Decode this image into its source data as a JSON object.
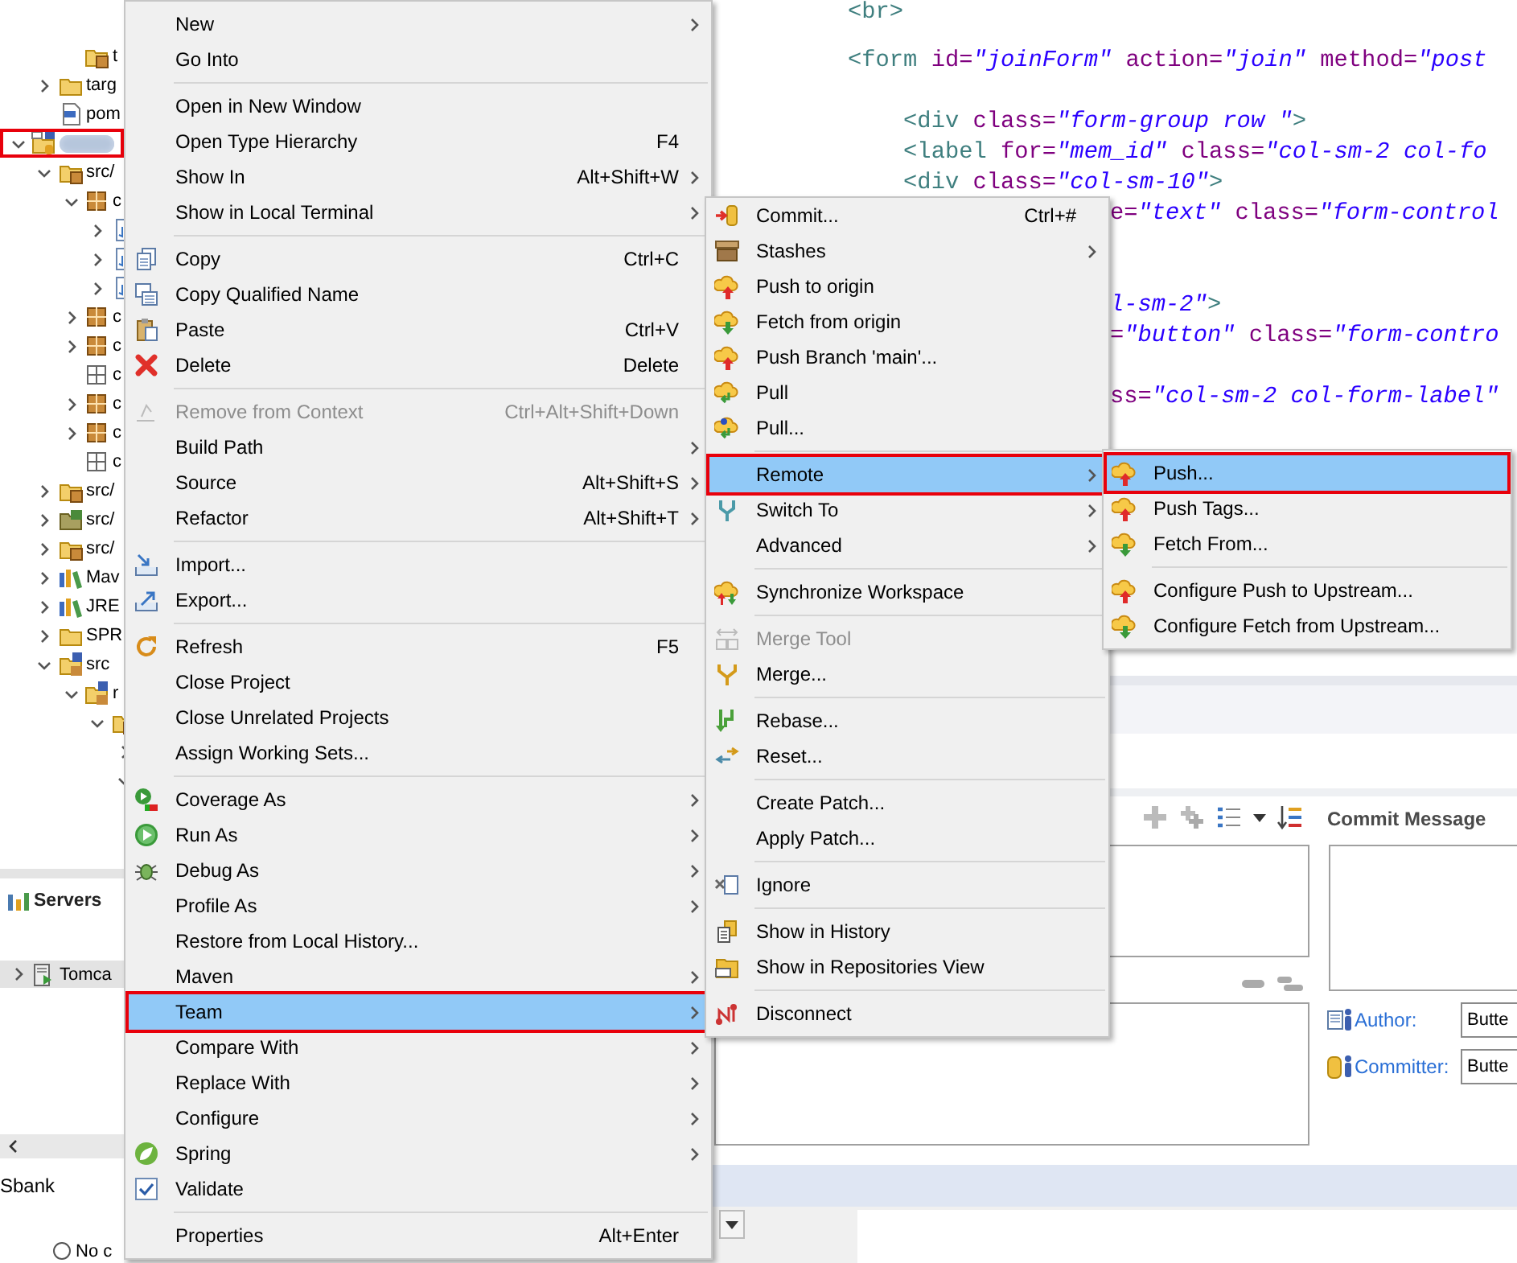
{
  "project_explorer": {
    "tree": [
      {
        "kind": "offscreen",
        "children": [
          {
            "kind": "offscreen",
            "children": [
              {
                "label": "t",
                "kind": "source-folder"
              }
            ]
          },
          {
            "label": "targ",
            "kind": "folder",
            "expanded": false
          },
          {
            "label": "pom",
            "kind": "pom"
          }
        ]
      },
      {
        "kind": "project",
        "redacted": true,
        "callout": true,
        "expanded": true,
        "children": [
          {
            "label": "src/",
            "kind": "source-folder",
            "expanded": true,
            "children": [
              {
                "label": "c",
                "kind": "package",
                "expanded": true,
                "children": [
                  {
                    "kind": "file",
                    "expanded": false
                  },
                  {
                    "kind": "file",
                    "expanded": false
                  },
                  {
                    "kind": "file",
                    "expanded": false
                  }
                ]
              },
              {
                "label": "c",
                "kind": "package",
                "expanded": false
              },
              {
                "label": "c",
                "kind": "package",
                "expanded": false
              },
              {
                "label": "c",
                "kind": "empty-package"
              },
              {
                "label": "c",
                "kind": "package",
                "expanded": false
              },
              {
                "label": "c",
                "kind": "package",
                "expanded": false
              },
              {
                "label": "c",
                "kind": "empty-package"
              }
            ]
          },
          {
            "label": "src/",
            "kind": "source-folder",
            "expanded": false
          },
          {
            "label": "src/",
            "kind": "resource-folder",
            "expanded": false
          },
          {
            "label": "src/",
            "kind": "source-folder",
            "expanded": false
          },
          {
            "label": "Mav",
            "kind": "library",
            "expanded": false
          },
          {
            "label": "JRE",
            "kind": "library",
            "expanded": false
          },
          {
            "label": "SPR",
            "kind": "folder",
            "expanded": false
          },
          {
            "label": "src",
            "kind": "spring-folder",
            "expanded": true,
            "children": [
              {
                "label": "r",
                "kind": "spring-folder",
                "expanded": true,
                "children": [
                  {
                    "kind": "source-folder",
                    "expanded": true,
                    "children": [
                      {
                        "expanded": false
                      },
                      {
                        "expanded": true
                      }
                    ]
                  }
                ]
              }
            ]
          }
        ]
      }
    ]
  },
  "servers_view": {
    "title": "Servers",
    "items": [
      {
        "label": "Tomca",
        "selected": true,
        "expanded": false
      }
    ]
  },
  "editor": {
    "lines": [
      {
        "kind": "full",
        "tokens": [
          {
            "kind": "tag",
            "t": "<br>"
          }
        ]
      },
      {
        "kind": "blank"
      },
      {
        "kind": "full",
        "tokens": [
          {
            "kind": "tag",
            "t": "<form"
          },
          {
            "kind": "attr",
            "t": " id="
          },
          {
            "kind": "val",
            "t": "\"joinForm\""
          },
          {
            "kind": "attr",
            "t": " action="
          },
          {
            "kind": "val",
            "t": "\"join\""
          },
          {
            "kind": "attr",
            "t": " method="
          },
          {
            "kind": "val",
            "t": "\"post"
          }
        ]
      },
      {
        "kind": "blank"
      },
      {
        "kind": "full",
        "tokens": [
          {
            "kind": "tag",
            "t": "    <div"
          },
          {
            "kind": "attr",
            "t": " class="
          },
          {
            "kind": "val",
            "t": "\"form-group row \""
          },
          {
            "kind": "tag",
            "t": ">"
          }
        ]
      },
      {
        "kind": "full",
        "tokens": [
          {
            "kind": "tag",
            "t": "    <label"
          },
          {
            "kind": "attr",
            "t": " for="
          },
          {
            "kind": "val",
            "t": "\"mem_id\""
          },
          {
            "kind": "attr",
            "t": " class="
          },
          {
            "kind": "val",
            "t": "\"col-sm-2 col-fo"
          }
        ]
      },
      {
        "kind": "full",
        "tokens": [
          {
            "kind": "tag",
            "t": "    <div"
          },
          {
            "kind": "attr",
            "t": " class="
          },
          {
            "kind": "val",
            "t": "\"col-sm-10\""
          },
          {
            "kind": "tag",
            "t": ">"
          }
        ]
      },
      {
        "kind": "tail",
        "tokens": [
          {
            "kind": "attr",
            "t": "e="
          },
          {
            "kind": "val",
            "t": "\"text\""
          },
          {
            "kind": "attr",
            "t": " class="
          },
          {
            "kind": "val",
            "t": "\"form-control"
          }
        ]
      },
      {
        "kind": "blank"
      },
      {
        "kind": "blank"
      },
      {
        "kind": "tail",
        "tokens": [
          {
            "kind": "val",
            "t": "l-sm-2\""
          },
          {
            "kind": "tag",
            "t": ">"
          }
        ]
      },
      {
        "kind": "tail",
        "tokens": [
          {
            "kind": "attr",
            "t": "="
          },
          {
            "kind": "val",
            "t": "\"button\""
          },
          {
            "kind": "attr",
            "t": " class="
          },
          {
            "kind": "val",
            "t": "\"form-contro"
          }
        ]
      },
      {
        "kind": "blank"
      },
      {
        "kind": "tail",
        "tokens": [
          {
            "kind": "attr",
            "t": "ss="
          },
          {
            "kind": "val",
            "t": "\"col-sm-2 col-form-label\""
          }
        ]
      }
    ]
  },
  "staging": {
    "commit_message": {
      "label": "Commit Message"
    },
    "author": {
      "label": "Author:",
      "value": "Butte"
    },
    "committer": {
      "label": "Committer:",
      "value": "Butte"
    }
  },
  "status_bar": {
    "project": "Sbank"
  },
  "bottom_panel": {
    "radio": {
      "label": "No c",
      "selected": false
    }
  },
  "menus": [
    {
      "sections": [
        {
          "items": [
            {
              "label": "New",
              "submenu": true,
              "selected": false,
              "disabled": false
            },
            {
              "label": "Go Into",
              "selected": false,
              "disabled": false
            }
          ]
        },
        {
          "items": [
            {
              "label": "Open in New Window",
              "selected": false,
              "disabled": false
            },
            {
              "label": "Open Type Hierarchy",
              "shortcut": "F4",
              "selected": false,
              "disabled": false
            },
            {
              "label": "Show In",
              "shortcut": "Alt+Shift+W",
              "submenu": true,
              "selected": false,
              "disabled": false
            },
            {
              "label": "Show in Local Terminal",
              "submenu": true,
              "selected": false,
              "disabled": false
            }
          ]
        },
        {
          "items": [
            {
              "label": "Copy",
              "shortcut": "Ctrl+C",
              "selected": false,
              "disabled": false
            },
            {
              "label": "Copy Qualified Name",
              "selected": false,
              "disabled": false
            },
            {
              "label": "Paste",
              "shortcut": "Ctrl+V",
              "selected": false,
              "disabled": false
            },
            {
              "label": "Delete",
              "shortcut": "Delete",
              "selected": false,
              "disabled": false
            }
          ]
        },
        {
          "items": [
            {
              "label": "Remove from Context",
              "shortcut": "Ctrl+Alt+Shift+Down",
              "selected": false,
              "disabled": true
            },
            {
              "label": "Build Path",
              "submenu": true,
              "selected": false,
              "disabled": false
            },
            {
              "label": "Source",
              "shortcut": "Alt+Shift+S",
              "submenu": true,
              "selected": false,
              "disabled": false
            },
            {
              "label": "Refactor",
              "shortcut": "Alt+Shift+T",
              "submenu": true,
              "selected": false,
              "disabled": false
            }
          ]
        },
        {
          "items": [
            {
              "label": "Import...",
              "selected": false,
              "disabled": false
            },
            {
              "label": "Export...",
              "selected": false,
              "disabled": false
            }
          ]
        },
        {
          "items": [
            {
              "label": "Refresh",
              "shortcut": "F5",
              "selected": false,
              "disabled": false
            },
            {
              "label": "Close Project",
              "selected": false,
              "disabled": false
            },
            {
              "label": "Close Unrelated Projects",
              "selected": false,
              "disabled": false
            },
            {
              "label": "Assign Working Sets...",
              "selected": false,
              "disabled": false
            }
          ]
        },
        {
          "items": [
            {
              "label": "Coverage As",
              "submenu": true,
              "selected": false,
              "disabled": false
            },
            {
              "label": "Run As",
              "submenu": true,
              "selected": false,
              "disabled": false
            },
            {
              "label": "Debug As",
              "submenu": true,
              "selected": false,
              "disabled": false
            },
            {
              "label": "Profile As",
              "submenu": true,
              "selected": false,
              "disabled": false
            },
            {
              "label": "Restore from Local History...",
              "selected": false,
              "disabled": false
            },
            {
              "label": "Maven",
              "submenu": true,
              "selected": false,
              "disabled": false
            },
            {
              "label": "Team",
              "submenu": true,
              "selected": true,
              "disabled": false,
              "callout": true
            },
            {
              "label": "Compare With",
              "submenu": true,
              "selected": false,
              "disabled": false
            },
            {
              "label": "Replace With",
              "submenu": true,
              "selected": false,
              "disabled": false
            },
            {
              "label": "Configure",
              "submenu": true,
              "selected": false,
              "disabled": false
            },
            {
              "label": "Spring",
              "submenu": true,
              "selected": false,
              "disabled": false
            },
            {
              "label": "Validate",
              "selected": false,
              "disabled": false
            }
          ]
        },
        {
          "items": [
            {
              "label": "Properties",
              "shortcut": "Alt+Enter",
              "selected": false,
              "disabled": false
            }
          ]
        }
      ]
    },
    {
      "sections": [
        {
          "items": [
            {
              "label": "Commit...",
              "shortcut": "Ctrl+#",
              "selected": false,
              "disabled": false
            },
            {
              "label": "Stashes",
              "submenu": true,
              "selected": false,
              "disabled": false
            },
            {
              "label": "Push to origin",
              "selected": false,
              "disabled": false
            },
            {
              "label": "Fetch from origin",
              "selected": false,
              "disabled": false
            },
            {
              "label": "Push Branch 'main'...",
              "selected": false,
              "disabled": false
            },
            {
              "label": "Pull",
              "selected": false,
              "disabled": false
            },
            {
              "label": "Pull...",
              "selected": false,
              "disabled": false
            }
          ]
        },
        {
          "items": [
            {
              "label": "Remote",
              "submenu": true,
              "selected": true,
              "disabled": false,
              "callout": true
            },
            {
              "label": "Switch To",
              "submenu": true,
              "selected": false,
              "disabled": false
            },
            {
              "label": "Advanced",
              "submenu": true,
              "selected": false,
              "disabled": false
            }
          ]
        },
        {
          "items": [
            {
              "label": "Synchronize Workspace",
              "selected": false,
              "disabled": false
            }
          ]
        },
        {
          "items": [
            {
              "label": "Merge Tool",
              "selected": false,
              "disabled": true
            },
            {
              "label": "Merge...",
              "selected": false,
              "disabled": false
            }
          ]
        },
        {
          "items": [
            {
              "label": "Rebase...",
              "selected": false,
              "disabled": false
            },
            {
              "label": "Reset...",
              "selected": false,
              "disabled": false
            }
          ]
        },
        {
          "items": [
            {
              "label": "Create Patch...",
              "selected": false,
              "disabled": false
            },
            {
              "label": "Apply Patch...",
              "selected": false,
              "disabled": false
            }
          ]
        },
        {
          "items": [
            {
              "label": "Ignore",
              "selected": false,
              "disabled": false
            }
          ]
        },
        {
          "items": [
            {
              "label": "Show in History",
              "selected": false,
              "disabled": false
            },
            {
              "label": "Show in Repositories View",
              "selected": false,
              "disabled": false
            }
          ]
        },
        {
          "items": [
            {
              "label": "Disconnect",
              "selected": false,
              "disabled": false
            }
          ]
        }
      ]
    },
    {
      "sections": [
        {
          "items": [
            {
              "label": "Push...",
              "selected": true,
              "disabled": false,
              "callout": true
            },
            {
              "label": "Push Tags...",
              "selected": false,
              "disabled": false
            },
            {
              "label": "Fetch From...",
              "selected": false,
              "disabled": false
            }
          ]
        },
        {
          "items": [
            {
              "label": "Configure Push to Upstream...",
              "selected": false,
              "disabled": false
            },
            {
              "label": "Configure Fetch from Upstream...",
              "selected": false,
              "disabled": false
            }
          ]
        }
      ]
    }
  ]
}
